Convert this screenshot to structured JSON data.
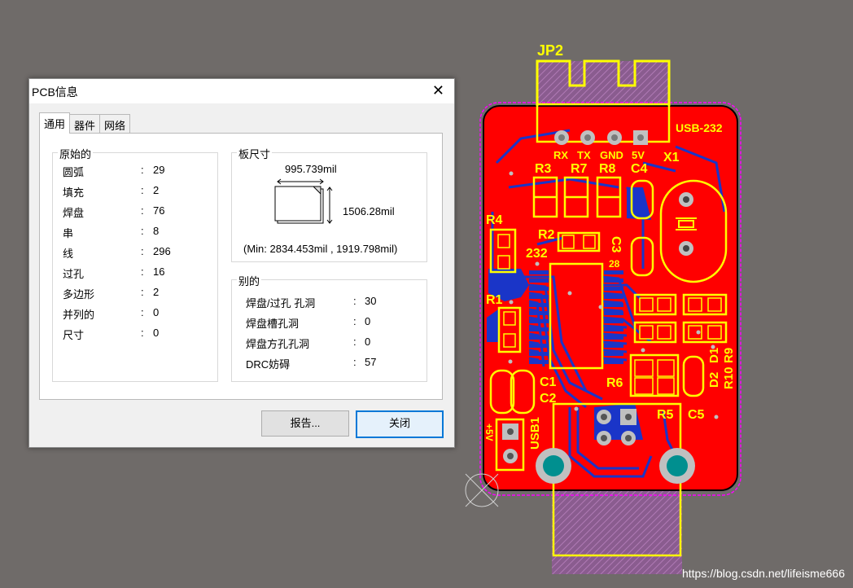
{
  "dialog": {
    "title": "PCB信息",
    "close_glyph": "✕",
    "tabs": [
      "通用",
      "器件",
      "网络"
    ],
    "primitives": {
      "label": "原始的",
      "rows": [
        {
          "key": "圆弧",
          "value": "29"
        },
        {
          "key": "填充",
          "value": "2"
        },
        {
          "key": "焊盘",
          "value": "76"
        },
        {
          "key": "串",
          "value": "8"
        },
        {
          "key": "线",
          "value": "296"
        },
        {
          "key": "过孔",
          "value": "16"
        },
        {
          "key": "多边形",
          "value": "2"
        },
        {
          "key": "并列的",
          "value": "0"
        },
        {
          "key": "尺寸",
          "value": "0"
        }
      ]
    },
    "board_size": {
      "label": "板尺寸",
      "width": "995.739mil",
      "height": "1506.28mil",
      "min": "(Min: 2834.453mil , 1919.798mil)"
    },
    "other": {
      "label": "别的",
      "rows": [
        {
          "key": "焊盘/过孔 孔洞",
          "value": "30"
        },
        {
          "key": "焊盘槽孔洞",
          "value": "0"
        },
        {
          "key": "焊盘方孔孔洞",
          "value": "0"
        },
        {
          "key": "DRC妨碍",
          "value": "57"
        }
      ]
    },
    "colon": ":",
    "report_button": "报告...",
    "close_button": "关闭"
  },
  "pcb": {
    "board_name": "USB-232",
    "labels": {
      "jp2": "JP2",
      "x1": "X1",
      "r3": "R3",
      "r7": "R7",
      "r8": "R8",
      "c4": "C4",
      "r4": "R4",
      "r2": "R2",
      "ic": "232",
      "c3": "C3",
      "pin28": "28",
      "r1": "R1",
      "c1": "C1",
      "c2": "C2",
      "r6": "R6",
      "d2": "D2",
      "d1": "D1",
      "r10": "R10",
      "r9": "R9",
      "r5": "R5",
      "c5": "C5",
      "usb1": "USB1",
      "plus5v": "+5V",
      "rx": "RX",
      "tx": "TX",
      "gnd": "GND",
      "v5": "5V"
    },
    "colors": {
      "board": "#ff0000",
      "silk": "#ffff00",
      "copper_bottom": "#1a35c8",
      "pad": "#c0c0c0",
      "hole": "#008f8f"
    }
  },
  "watermark": "https://blog.csdn.net/lifeisme666"
}
